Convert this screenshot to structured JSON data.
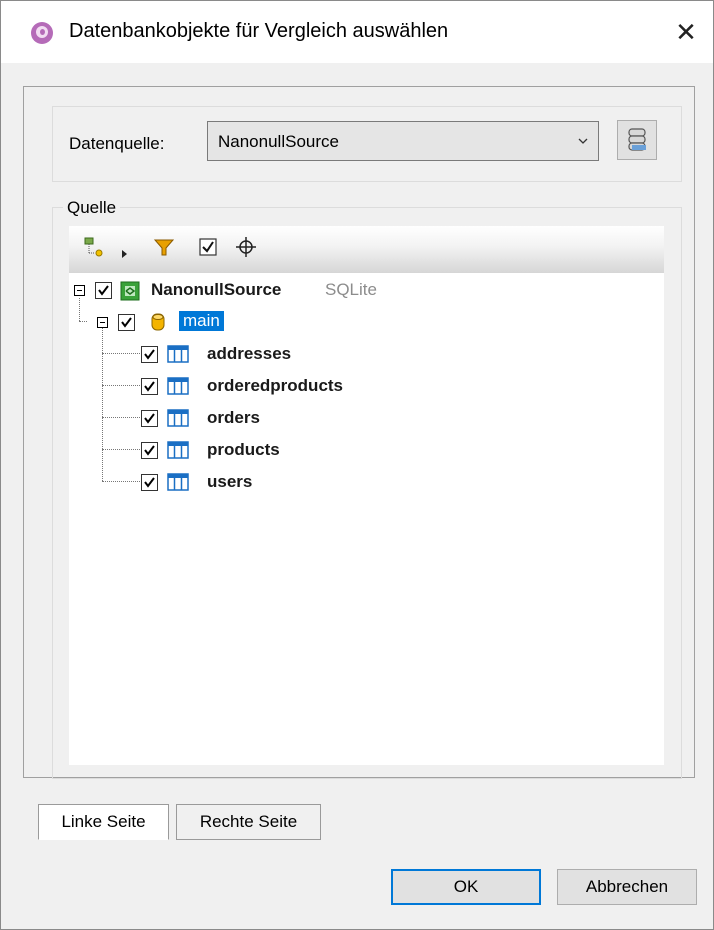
{
  "dialog": {
    "title": "Datenbankobjekte für Vergleich auswählen",
    "close_glyph": "✕"
  },
  "datasource": {
    "label": "Datenquelle:",
    "selected": "NanonullSource"
  },
  "source_group": {
    "label": "Quelle"
  },
  "toolbar": {
    "items": [
      "object-locator-icon",
      "dropdown-arrow-icon",
      "filter-icon",
      "check-all-icon",
      "crosshair-icon"
    ]
  },
  "tree": {
    "root": {
      "label": "NanonullSource",
      "type": "SQLite",
      "checked": true,
      "expanded": true
    },
    "schema": {
      "label": "main",
      "checked": true,
      "expanded": true,
      "selected": true
    },
    "tables": [
      {
        "label": "addresses",
        "checked": true
      },
      {
        "label": "orderedproducts",
        "checked": true
      },
      {
        "label": "orders",
        "checked": true
      },
      {
        "label": "products",
        "checked": true
      },
      {
        "label": "users",
        "checked": true
      }
    ]
  },
  "tabs": [
    {
      "label": "Linke Seite",
      "active": true
    },
    {
      "label": "Rechte Seite",
      "active": false
    }
  ],
  "buttons": {
    "ok": "OK",
    "cancel": "Abbrechen"
  },
  "colors": {
    "selection": "#0078d7",
    "filter": "#e8a000",
    "table_icon": "#1a6fc4",
    "db_icon": "#f4b400",
    "source_icon": "#3aa23a"
  }
}
